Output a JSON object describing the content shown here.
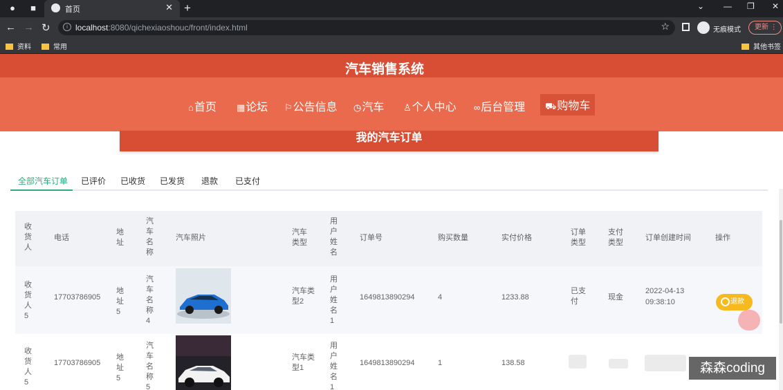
{
  "browser": {
    "tab_title": "首页",
    "url_host": "localhost",
    "url_rest": ":8080/qichexiaoshouc/front/index.html",
    "incognito_label": "无痕模式",
    "update_label": "更新",
    "bookmarks": [
      "资料",
      "常用"
    ],
    "other_bookmarks": "其他书签"
  },
  "site": {
    "title": "汽车销售系统",
    "nav": [
      {
        "icon": "home-icon",
        "label": "首页"
      },
      {
        "icon": "forum-icon",
        "label": "论坛"
      },
      {
        "icon": "flag-icon",
        "label": "公告信息"
      },
      {
        "icon": "clock-icon",
        "label": "汽车"
      },
      {
        "icon": "user-icon",
        "label": "个人中心"
      },
      {
        "icon": "link-icon",
        "label": "后台管理"
      },
      {
        "icon": "cart-icon",
        "label": "购物车"
      }
    ],
    "active_nav": "购物车"
  },
  "orders": {
    "title": "我的汽车订单",
    "tabs": [
      "全部汽车订单",
      "已评价",
      "已收货",
      "已发货",
      "退款",
      "已支付"
    ],
    "active_tab": "全部汽车订单",
    "columns": [
      "收货人",
      "电话",
      "地址",
      "汽车名称",
      "汽车照片",
      "汽车类型",
      "用户姓名",
      "订单号",
      "购买数量",
      "实付价格",
      "订单类型",
      "支付类型",
      "订单创建时间",
      "操作"
    ],
    "rows": [
      {
        "consignee": "收货人5",
        "phone": "17703786905",
        "address": "地址5",
        "car_name": "汽车名称4",
        "car_type": "汽车类型2",
        "user_name": "用户姓名1",
        "order_no": "1649813890294",
        "quantity": "4",
        "price": "1233.88",
        "order_type": "已支付",
        "pay_type": "现金",
        "created_date": "2022-04-13",
        "created_time": "09:38:10",
        "action": "退款"
      },
      {
        "consignee": "收货人5",
        "phone": "17703786905",
        "address": "地址5",
        "car_name": "汽车名称5",
        "car_type": "汽车类型1",
        "user_name": "用户姓名1",
        "order_no": "1649813890294",
        "quantity": "1",
        "price": "138.58"
      }
    ]
  },
  "watermark": "森森coding",
  "colors": {
    "header": "#d74e35",
    "nav": "#ea6a4e",
    "tab_active": "#2dab7a",
    "refund": "#f7ba1e"
  }
}
